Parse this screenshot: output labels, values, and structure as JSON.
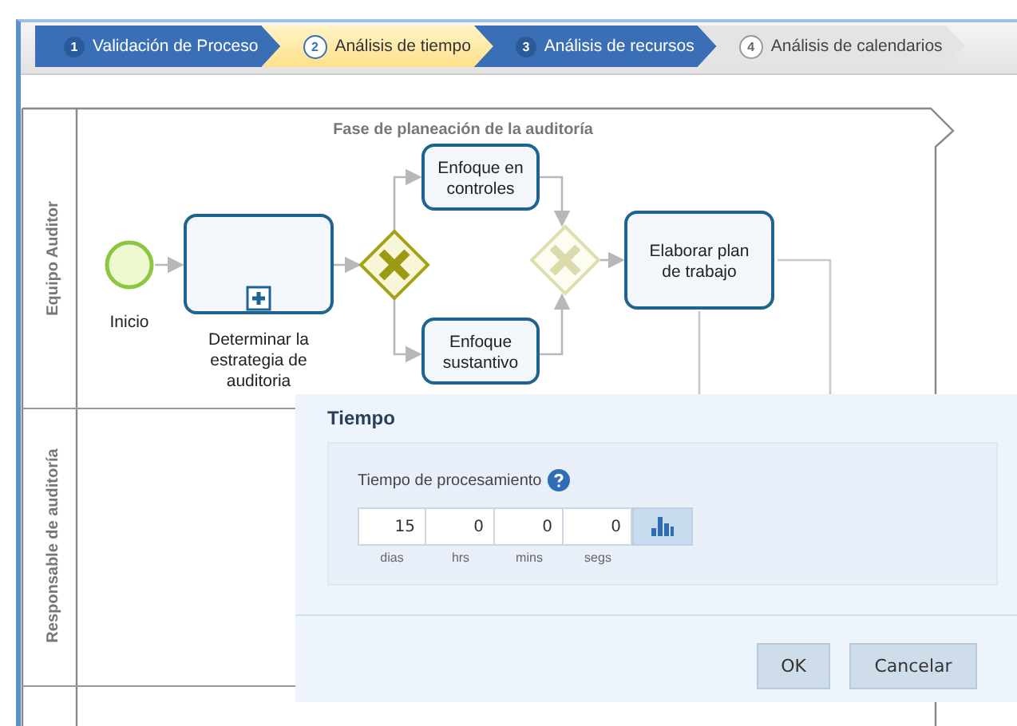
{
  "wizard": {
    "steps": [
      {
        "number": "1",
        "label": "Validación de Proceso",
        "selected": false,
        "completed": true
      },
      {
        "number": "2",
        "label": "Análisis de tiempo",
        "selected": true,
        "completed": false
      },
      {
        "number": "3",
        "label": "Análisis de recursos",
        "selected": false,
        "completed": true
      },
      {
        "number": "4",
        "label": "Análisis de calendarios",
        "selected": false,
        "completed": false
      }
    ]
  },
  "diagram": {
    "phase_title": "Fase de planeación de la auditoría",
    "lanes": [
      "Equipo Auditor",
      "Responsable de auditoría"
    ],
    "nodes": [
      {
        "kind": "start",
        "label": "Inicio"
      },
      {
        "kind": "subprocess",
        "label": "Determinar la estrategia de auditoria"
      },
      {
        "kind": "gateway",
        "disabled": false
      },
      {
        "kind": "task",
        "label": "Enfoque en controles"
      },
      {
        "kind": "task",
        "label": "Enfoque sustantivo"
      },
      {
        "kind": "gateway",
        "disabled": true
      },
      {
        "kind": "task",
        "label": "Elaborar plan de trabajo"
      }
    ]
  },
  "dialog": {
    "title": "Tiempo",
    "field_label": "Tiempo de procesamiento",
    "fields": [
      {
        "value": "15",
        "unit": "dias"
      },
      {
        "value": "0",
        "unit": "hrs"
      },
      {
        "value": "0",
        "unit": "mins"
      },
      {
        "value": "0",
        "unit": "segs"
      }
    ],
    "buttons": [
      "OK",
      "Cancelar"
    ]
  }
}
